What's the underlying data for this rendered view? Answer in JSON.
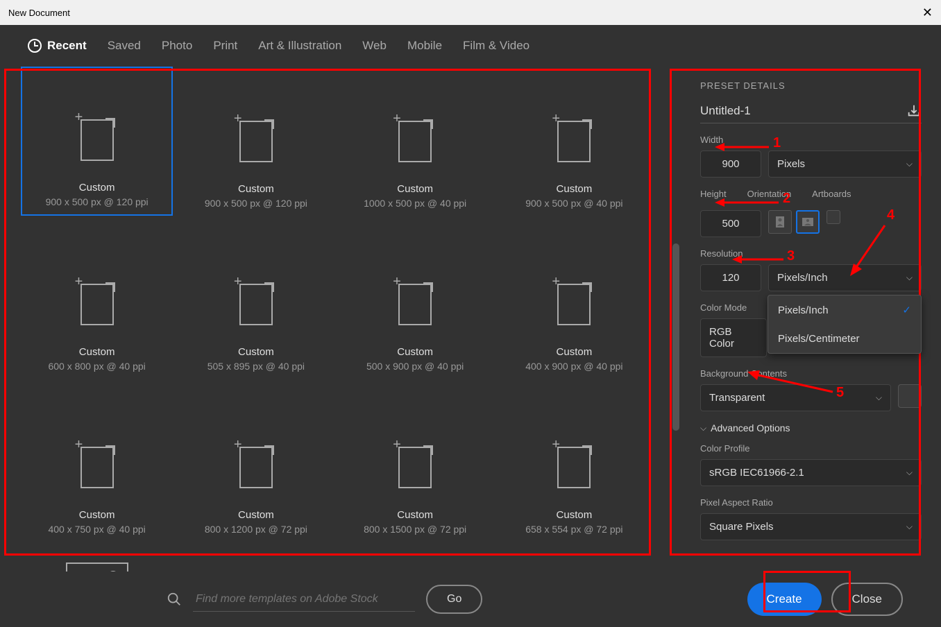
{
  "title": "New Document",
  "tabs": [
    "Recent",
    "Saved",
    "Photo",
    "Print",
    "Art & Illustration",
    "Web",
    "Mobile",
    "Film & Video"
  ],
  "active_tab": 0,
  "presets": [
    {
      "name": "Custom",
      "dim": "900 x 500 px @ 120 ppi",
      "selected": true
    },
    {
      "name": "Custom",
      "dim": "900 x 500 px @ 120 ppi"
    },
    {
      "name": "Custom",
      "dim": "1000 x 500 px @ 40 ppi"
    },
    {
      "name": "Custom",
      "dim": "900 x 500 px @ 40 ppi"
    },
    {
      "name": "Custom",
      "dim": "600 x 800 px @ 40 ppi"
    },
    {
      "name": "Custom",
      "dim": "505 x 895 px @ 40 ppi"
    },
    {
      "name": "Custom",
      "dim": "500 x 900 px @ 40 ppi"
    },
    {
      "name": "Custom",
      "dim": "400 x 900 px @ 40 ppi"
    },
    {
      "name": "Custom",
      "dim": "400 x 750 px @ 40 ppi"
    },
    {
      "name": "Custom",
      "dim": "800 x 1200 px @ 72 ppi"
    },
    {
      "name": "Custom",
      "dim": "800 x 1500 px @ 72 ppi"
    },
    {
      "name": "Custom",
      "dim": "658 x 554 px @ 72 ppi"
    }
  ],
  "details": {
    "panel_title": "PRESET DETAILS",
    "doc_name": "Untitled-1",
    "width_label": "Width",
    "width_value": "900",
    "width_unit": "Pixels",
    "height_label": "Height",
    "height_value": "500",
    "orientation_label": "Orientation",
    "artboards_label": "Artboards",
    "resolution_label": "Resolution",
    "resolution_value": "120",
    "resolution_unit": "Pixels/Inch",
    "resolution_options": [
      "Pixels/Inch",
      "Pixels/Centimeter"
    ],
    "color_mode_label": "Color Mode",
    "color_mode_value": "RGB Color",
    "bg_label": "Background Contents",
    "bg_value": "Transparent",
    "advanced_label": "Advanced Options",
    "profile_label": "Color Profile",
    "profile_value": "sRGB IEC61966-2.1",
    "par_label": "Pixel Aspect Ratio",
    "par_value": "Square Pixels"
  },
  "search": {
    "placeholder": "Find more templates on Adobe Stock",
    "go": "Go"
  },
  "buttons": {
    "create": "Create",
    "close": "Close"
  },
  "annotations": [
    "1",
    "2",
    "3",
    "4",
    "5"
  ]
}
